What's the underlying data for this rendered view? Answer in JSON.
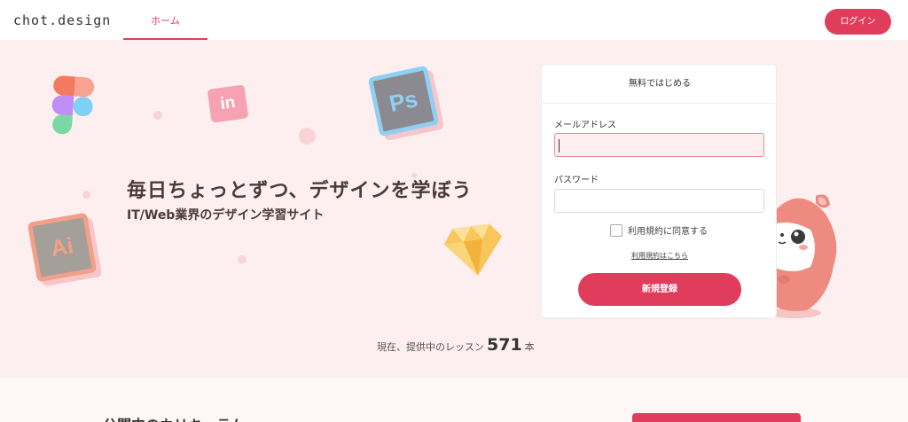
{
  "header": {
    "logo": "chot.design",
    "nav_home": "ホーム",
    "login_label": "ログイン"
  },
  "hero": {
    "headline": "毎日ちょっとずつ、デザインを学ぼう",
    "subline": "IT/Web業界のデザイン学習サイト",
    "lessons_prefix": "現在、提供中のレッスン",
    "lessons_count": "571",
    "lessons_suffix": "本",
    "icons": {
      "photoshop": "Ps",
      "illustrator": "Ai",
      "invision": "in"
    }
  },
  "signup_card": {
    "title": "無料ではじめる",
    "email_label": "メールアドレス",
    "email_value": "",
    "password_label": "パスワード",
    "password_value": "",
    "terms_checkbox_label": "利用規約に同意する",
    "terms_link": "利用規約はこちら",
    "submit_label": "新規登録"
  },
  "section": {
    "title": "公開中のカリキュラム"
  },
  "colors": {
    "accent": "#e03d5c",
    "hero_bg": "#fdeff0"
  }
}
